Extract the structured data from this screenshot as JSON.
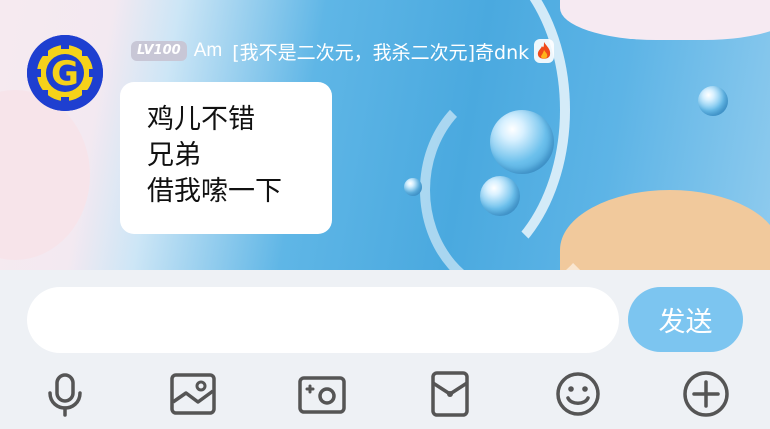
{
  "chat": {
    "sender": {
      "avatar_letter": "G",
      "level_badge": "LV100",
      "nickname": "Am",
      "group_title": "[我不是二次元，我杀二次元]奇dnk"
    },
    "message": {
      "lines": [
        "鸡儿不错",
        "兄弟",
        "借我嗦一下"
      ]
    }
  },
  "composer": {
    "input_value": "",
    "send_label": "发送"
  },
  "toolbar": {
    "icons": [
      "microphone-icon",
      "image-icon",
      "camera-icon",
      "red-envelope-icon",
      "emoji-icon",
      "plus-icon"
    ]
  },
  "colors": {
    "send_button": "#7cc5f0",
    "avatar_blue": "#1e3fd0",
    "avatar_yellow": "#f5d21a",
    "level_badge": "#c8c7d6",
    "toolbar_icon": "#555555"
  }
}
